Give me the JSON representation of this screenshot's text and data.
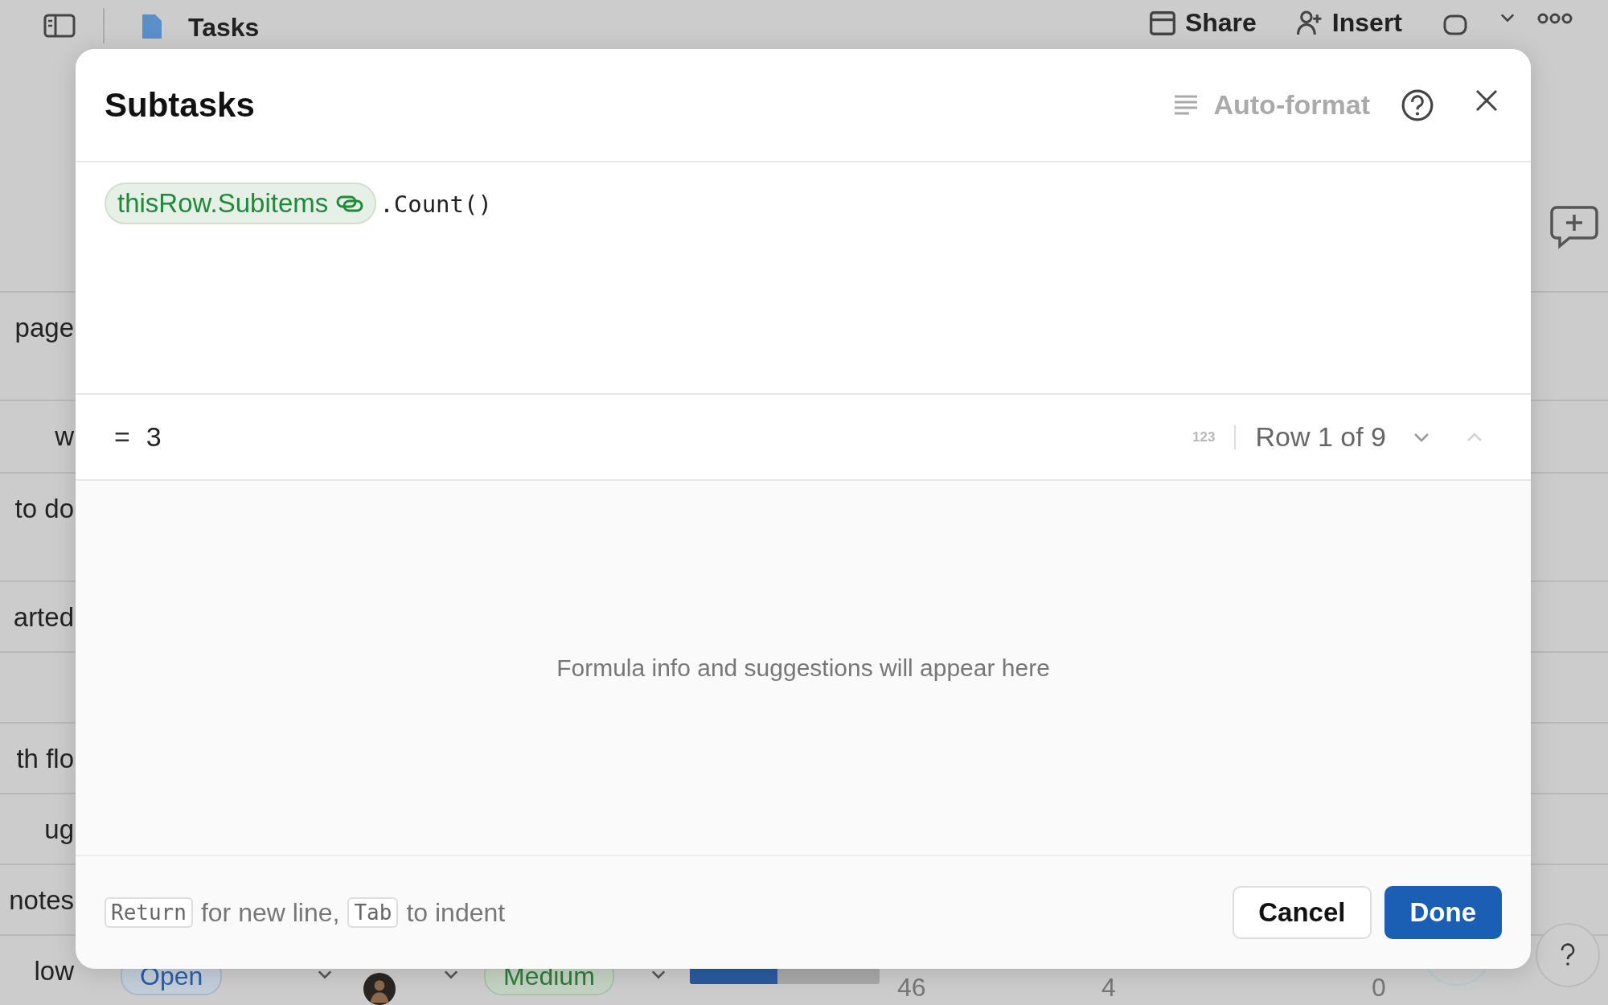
{
  "app_bar": {
    "title": "Tasks",
    "actions": [
      "Share",
      "Insert"
    ]
  },
  "list_rows": [
    {
      "label": "page"
    },
    {
      "label": "w"
    },
    {
      "label": "to do"
    },
    {
      "label": "arted"
    },
    {},
    {
      "label": "th flo"
    },
    {
      "label": "ug"
    },
    {
      "label": "notes"
    },
    {
      "label": "low"
    }
  ],
  "table_row": {
    "status": "Open",
    "priority": "Medium",
    "progress": {
      "level": 0.46
    },
    "cells": [
      "46",
      "4",
      "0"
    ]
  },
  "dialog": {
    "title": "Subtasks",
    "auto_format": "Auto-format",
    "formula": {
      "column_ref": "thisRow.Subitems",
      "call": ".Count()"
    },
    "result": {
      "operator": "=",
      "value": "3",
      "type_badge": "123",
      "row_label": "Row 1 of 9",
      "next_disabled": false,
      "prev_disabled": true
    },
    "info": "Formula info and suggestions will appear here",
    "hint": [
      {
        "kind": "key",
        "text": "Return"
      },
      {
        "kind": "text",
        "text": "for new line,"
      },
      {
        "kind": "key",
        "text": "Tab"
      },
      {
        "kind": "text",
        "text": "to indent"
      }
    ],
    "buttons": [
      "Cancel",
      "Done"
    ]
  }
}
